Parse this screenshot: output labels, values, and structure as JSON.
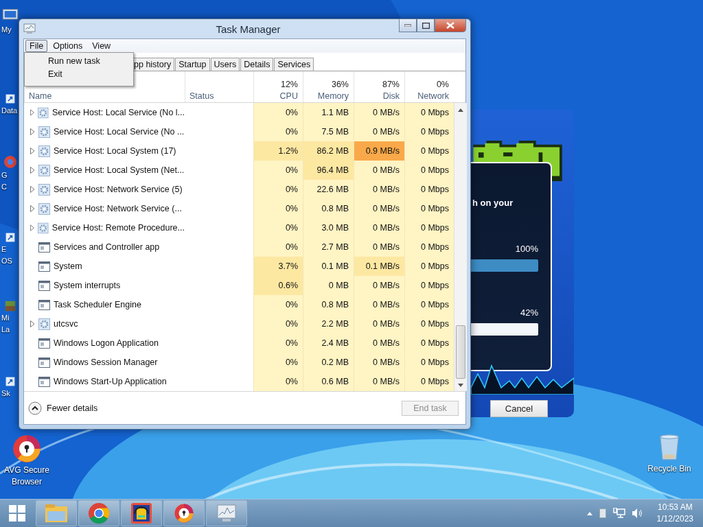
{
  "desktop_icons": [
    {
      "kind": "computer",
      "lines": [
        "My"
      ]
    },
    {
      "kind": "app",
      "lines": [
        "Data"
      ]
    },
    {
      "kind": "browser",
      "lines": [
        "G",
        "C"
      ]
    },
    {
      "kind": "app",
      "lines": [
        "E",
        "OS"
      ]
    },
    {
      "kind": "game",
      "lines": [
        "Mi",
        "La"
      ]
    },
    {
      "kind": "app",
      "lines": [
        "Sk"
      ]
    },
    {
      "kind": "avg",
      "lines": [
        "AVG Secure",
        "Browser"
      ]
    },
    {
      "kind": "recycle",
      "lines": [
        "Recycle Bin"
      ]
    }
  ],
  "installer": {
    "text": "h on your",
    "bars": [
      {
        "label": "100%",
        "filled": true
      },
      {
        "label": "42%",
        "filled": false
      }
    ],
    "cancel": "Cancel"
  },
  "window": {
    "title": "Task Manager",
    "menus": [
      {
        "label": "File",
        "selected": true
      },
      {
        "label": "Options",
        "selected": false
      },
      {
        "label": "View",
        "selected": false
      }
    ],
    "file_menu": [
      "Run new task",
      "Exit"
    ],
    "tabs": [
      {
        "label": "pp history",
        "selected": false
      },
      {
        "label": "Startup",
        "selected": false
      },
      {
        "label": "Users",
        "selected": false
      },
      {
        "label": "Details",
        "selected": false
      },
      {
        "label": "Services",
        "selected": false
      }
    ],
    "columns": [
      {
        "label": "Name"
      },
      {
        "label": "Status"
      },
      {
        "label": "CPU",
        "total": "12%"
      },
      {
        "label": "Memory",
        "total": "36%"
      },
      {
        "label": "Disk",
        "total": "87%"
      },
      {
        "label": "Network",
        "total": "0%"
      }
    ],
    "rows": [
      {
        "name": "Service Host: Local Service (No l...",
        "kind": "service",
        "expandable": true,
        "values": [
          {
            "text": "0%",
            "warm": false,
            "hot": false
          },
          {
            "text": "1.1 MB",
            "warm": false,
            "hot": false
          },
          {
            "text": "0 MB/s",
            "warm": false,
            "hot": false
          },
          {
            "text": "0 Mbps",
            "warm": false,
            "hot": false
          }
        ]
      },
      {
        "name": "Service Host: Local Service (No ...",
        "kind": "service",
        "expandable": true,
        "values": [
          {
            "text": "0%",
            "warm": false,
            "hot": false
          },
          {
            "text": "7.5 MB",
            "warm": false,
            "hot": false
          },
          {
            "text": "0 MB/s",
            "warm": false,
            "hot": false
          },
          {
            "text": "0 Mbps",
            "warm": false,
            "hot": false
          }
        ]
      },
      {
        "name": "Service Host: Local System (17)",
        "kind": "service",
        "expandable": true,
        "values": [
          {
            "text": "1.2%",
            "warm": true,
            "hot": false
          },
          {
            "text": "86.2 MB",
            "warm": true,
            "hot": false
          },
          {
            "text": "0.9 MB/s",
            "warm": false,
            "hot": true
          },
          {
            "text": "0 Mbps",
            "warm": false,
            "hot": false
          }
        ]
      },
      {
        "name": "Service Host: Local System (Net...",
        "kind": "service",
        "expandable": true,
        "values": [
          {
            "text": "0%",
            "warm": false,
            "hot": false
          },
          {
            "text": "96.4 MB",
            "warm": true,
            "hot": false
          },
          {
            "text": "0 MB/s",
            "warm": false,
            "hot": false
          },
          {
            "text": "0 Mbps",
            "warm": false,
            "hot": false
          }
        ]
      },
      {
        "name": "Service Host: Network Service (5)",
        "kind": "service",
        "expandable": true,
        "values": [
          {
            "text": "0%",
            "warm": false,
            "hot": false
          },
          {
            "text": "22.6 MB",
            "warm": false,
            "hot": false
          },
          {
            "text": "0 MB/s",
            "warm": false,
            "hot": false
          },
          {
            "text": "0 Mbps",
            "warm": false,
            "hot": false
          }
        ]
      },
      {
        "name": "Service Host: Network Service (...",
        "kind": "service",
        "expandable": true,
        "values": [
          {
            "text": "0%",
            "warm": false,
            "hot": false
          },
          {
            "text": "0.8 MB",
            "warm": false,
            "hot": false
          },
          {
            "text": "0 MB/s",
            "warm": false,
            "hot": false
          },
          {
            "text": "0 Mbps",
            "warm": false,
            "hot": false
          }
        ]
      },
      {
        "name": "Service Host: Remote Procedure...",
        "kind": "service",
        "expandable": true,
        "values": [
          {
            "text": "0%",
            "warm": false,
            "hot": false
          },
          {
            "text": "3.0 MB",
            "warm": false,
            "hot": false
          },
          {
            "text": "0 MB/s",
            "warm": false,
            "hot": false
          },
          {
            "text": "0 Mbps",
            "warm": false,
            "hot": false
          }
        ]
      },
      {
        "name": "Services and Controller app",
        "kind": "app",
        "expandable": false,
        "values": [
          {
            "text": "0%",
            "warm": false,
            "hot": false
          },
          {
            "text": "2.7 MB",
            "warm": false,
            "hot": false
          },
          {
            "text": "0 MB/s",
            "warm": false,
            "hot": false
          },
          {
            "text": "0 Mbps",
            "warm": false,
            "hot": false
          }
        ]
      },
      {
        "name": "System",
        "kind": "app",
        "expandable": false,
        "values": [
          {
            "text": "3.7%",
            "warm": true,
            "hot": false
          },
          {
            "text": "0.1 MB",
            "warm": false,
            "hot": false
          },
          {
            "text": "0.1 MB/s",
            "warm": true,
            "hot": false
          },
          {
            "text": "0 Mbps",
            "warm": false,
            "hot": false
          }
        ]
      },
      {
        "name": "System interrupts",
        "kind": "app",
        "expandable": false,
        "values": [
          {
            "text": "0.6%",
            "warm": true,
            "hot": false
          },
          {
            "text": "0 MB",
            "warm": false,
            "hot": false
          },
          {
            "text": "0 MB/s",
            "warm": false,
            "hot": false
          },
          {
            "text": "0 Mbps",
            "warm": false,
            "hot": false
          }
        ]
      },
      {
        "name": "Task Scheduler Engine",
        "kind": "app",
        "expandable": false,
        "values": [
          {
            "text": "0%",
            "warm": false,
            "hot": false
          },
          {
            "text": "0.8 MB",
            "warm": false,
            "hot": false
          },
          {
            "text": "0 MB/s",
            "warm": false,
            "hot": false
          },
          {
            "text": "0 Mbps",
            "warm": false,
            "hot": false
          }
        ]
      },
      {
        "name": "utcsvc",
        "kind": "service",
        "expandable": true,
        "values": [
          {
            "text": "0%",
            "warm": false,
            "hot": false
          },
          {
            "text": "2.2 MB",
            "warm": false,
            "hot": false
          },
          {
            "text": "0 MB/s",
            "warm": false,
            "hot": false
          },
          {
            "text": "0 Mbps",
            "warm": false,
            "hot": false
          }
        ]
      },
      {
        "name": "Windows Logon Application",
        "kind": "app",
        "expandable": false,
        "values": [
          {
            "text": "0%",
            "warm": false,
            "hot": false
          },
          {
            "text": "2.4 MB",
            "warm": false,
            "hot": false
          },
          {
            "text": "0 MB/s",
            "warm": false,
            "hot": false
          },
          {
            "text": "0 Mbps",
            "warm": false,
            "hot": false
          }
        ]
      },
      {
        "name": "Windows Session Manager",
        "kind": "app",
        "expandable": false,
        "values": [
          {
            "text": "0%",
            "warm": false,
            "hot": false
          },
          {
            "text": "0.2 MB",
            "warm": false,
            "hot": false
          },
          {
            "text": "0 MB/s",
            "warm": false,
            "hot": false
          },
          {
            "text": "0 Mbps",
            "warm": false,
            "hot": false
          }
        ]
      },
      {
        "name": "Windows Start-Up Application",
        "kind": "app",
        "expandable": false,
        "values": [
          {
            "text": "0%",
            "warm": false,
            "hot": false
          },
          {
            "text": "0.6 MB",
            "warm": false,
            "hot": false
          },
          {
            "text": "0 MB/s",
            "warm": false,
            "hot": false
          },
          {
            "text": "0 Mbps",
            "warm": false,
            "hot": false
          }
        ]
      }
    ],
    "fewer_details": "Fewer details",
    "end_task": {
      "label": "End task",
      "disabled": true
    }
  },
  "taskbar": {
    "apps": [
      {
        "kind": "folder"
      },
      {
        "kind": "chrome"
      },
      {
        "kind": "game"
      },
      {
        "kind": "avg"
      },
      {
        "kind": "monitor"
      }
    ],
    "time": "10:53 AM",
    "date": "1/12/2023"
  }
}
